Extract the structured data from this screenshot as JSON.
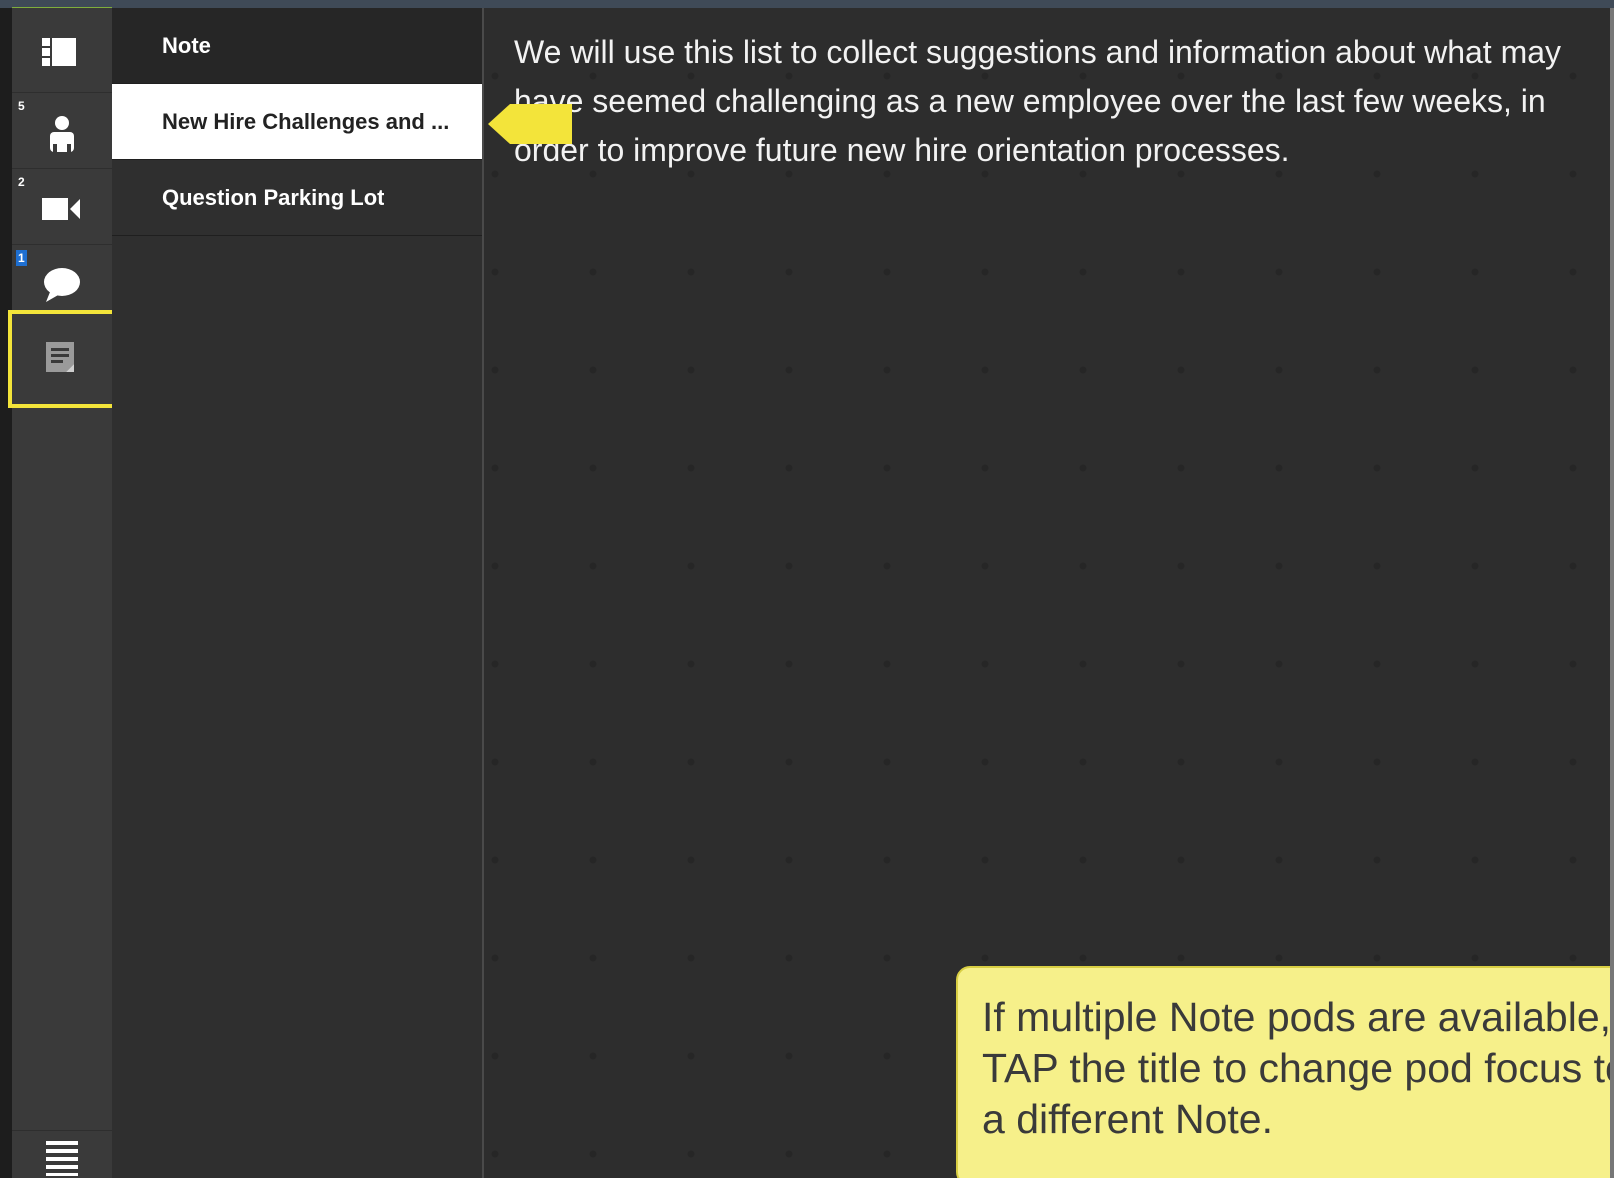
{
  "rail": {
    "items": [
      {
        "name": "layout-icon",
        "badge": ""
      },
      {
        "name": "attendees-icon",
        "badge": "5"
      },
      {
        "name": "camera-icon",
        "badge": "2"
      },
      {
        "name": "chat-icon",
        "badge": "1"
      },
      {
        "name": "notes-icon",
        "badge": ""
      }
    ],
    "menu_icon": "menu-icon"
  },
  "notes_list": {
    "header": "Note",
    "items": [
      {
        "title": "New Hire Challenges and ...",
        "selected": true
      },
      {
        "title": "Question Parking Lot",
        "selected": false
      }
    ]
  },
  "note": {
    "content": "We will use this list to collect suggestions and information about what may have seemed challenging as a new employee over the last few weeks, in order to improve future new hire orientation processes."
  },
  "tooltip": {
    "text": "If multiple Note pods are available, TAP the title to change pod focus to a different Note."
  },
  "colors": {
    "accent_green": "#7fae3c",
    "highlight_yellow": "#f3e43a",
    "badge_blue": "#1e6fd1",
    "tooltip_bg": "#f6f08a"
  }
}
